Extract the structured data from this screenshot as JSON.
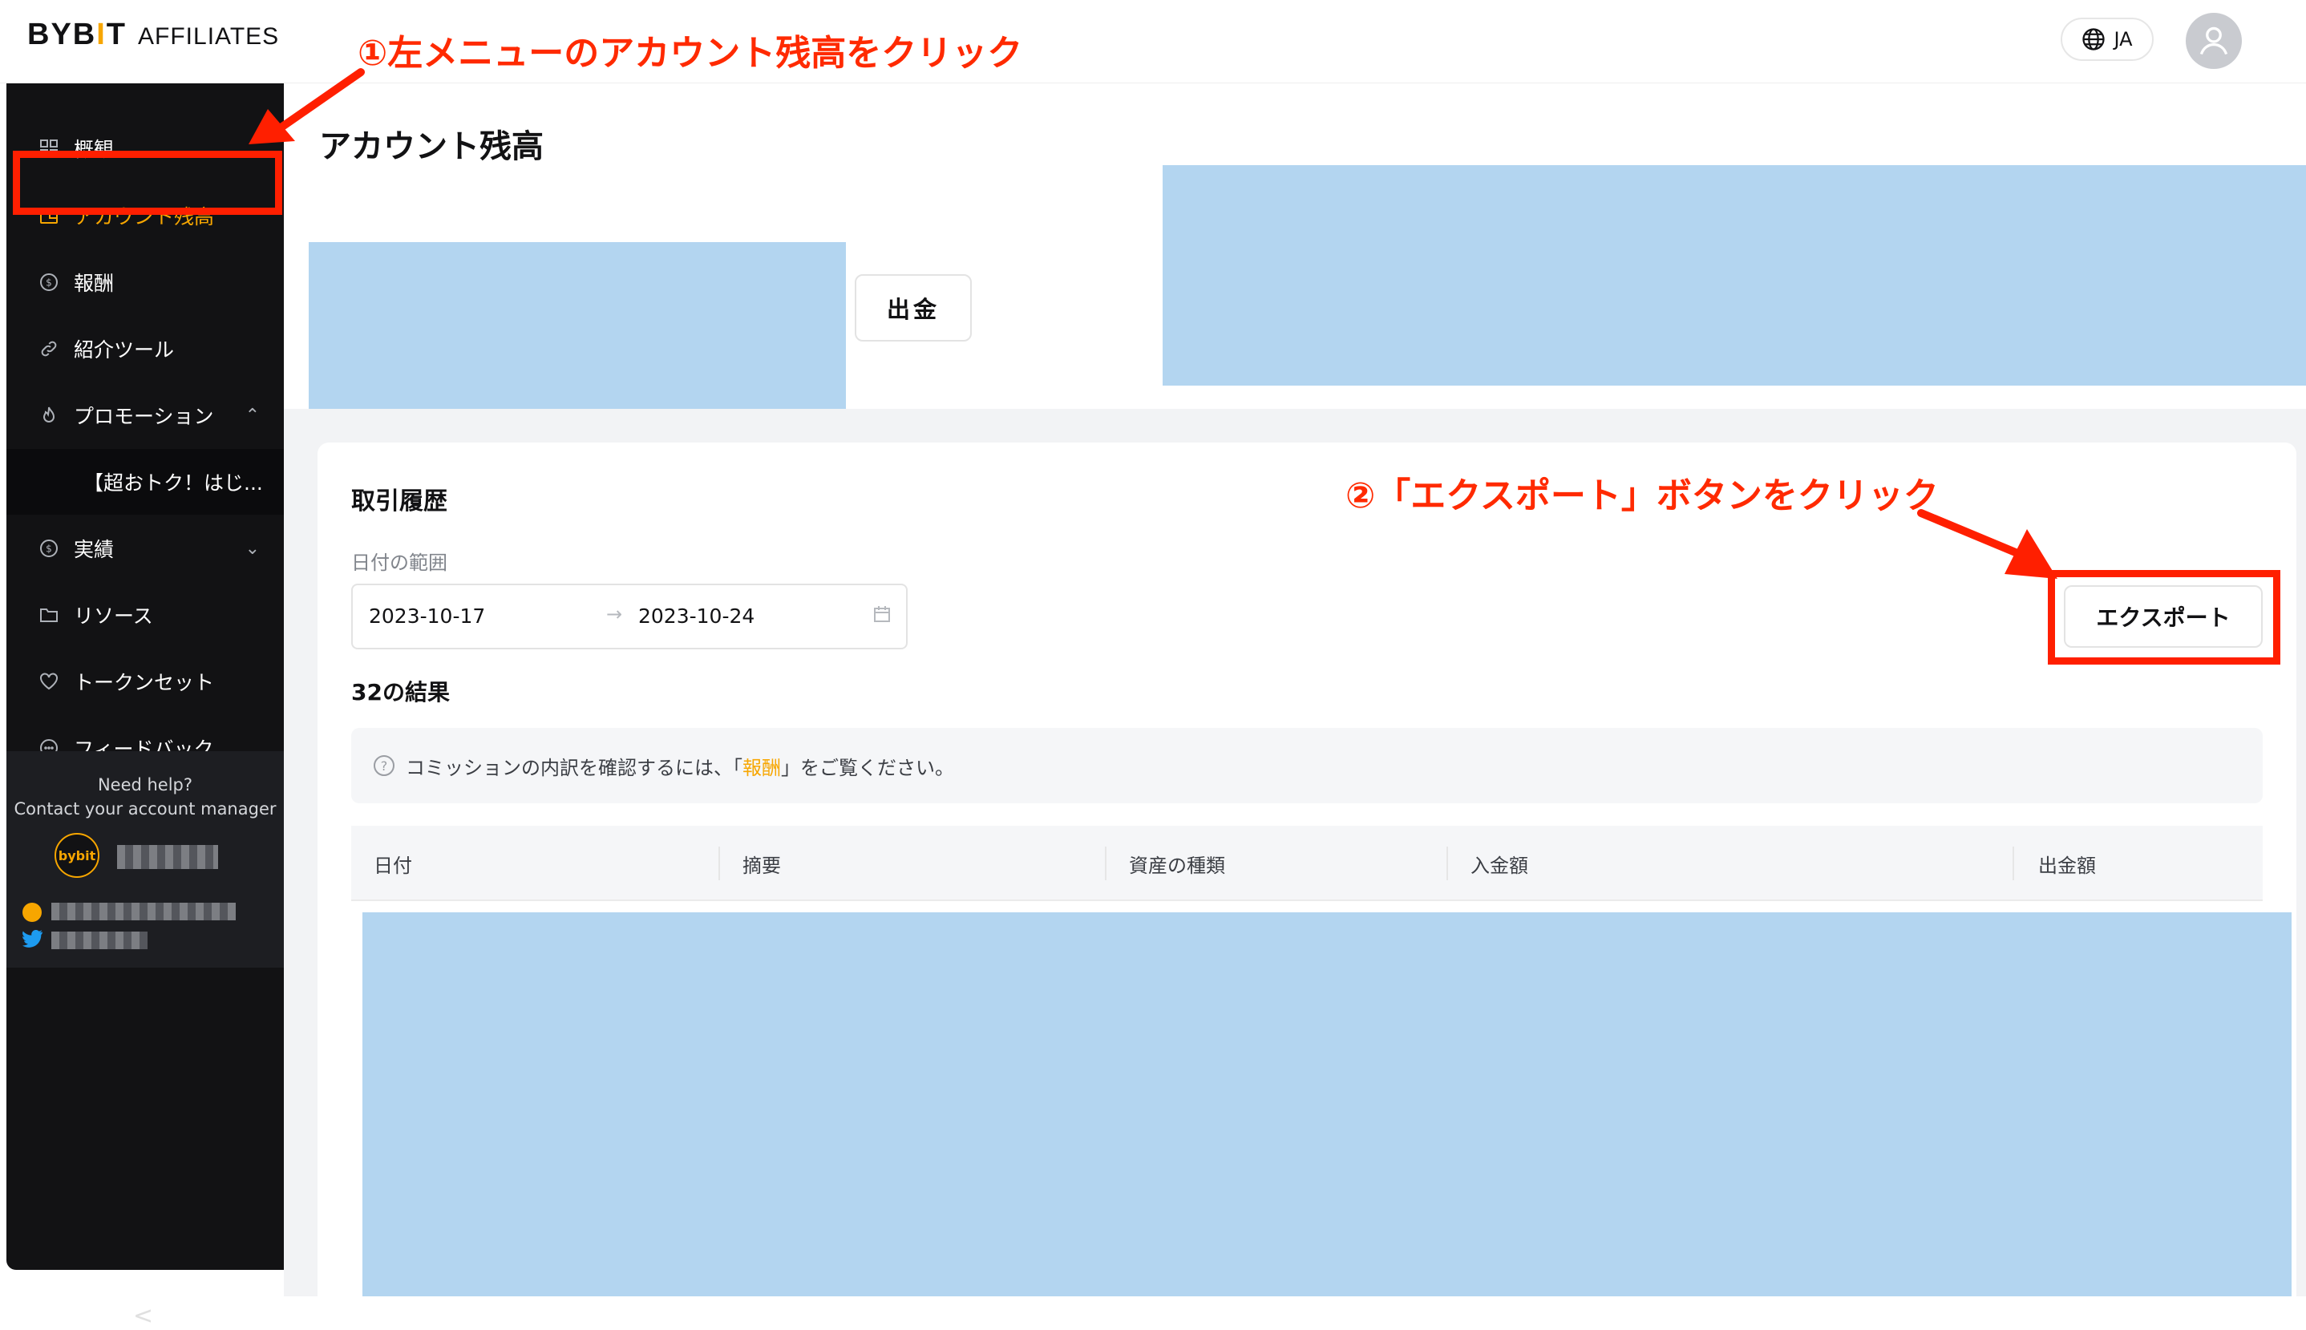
{
  "header": {
    "logo_mark": "BYB",
    "logo_mark_bar": "I",
    "logo_mark_end": "T",
    "logo_sub": "AFFILIATES",
    "language": "JA",
    "icons": [
      "globe-icon",
      "user-avatar-icon"
    ]
  },
  "sidebar": {
    "items": [
      {
        "label": "概観",
        "icon": "grid-icon"
      },
      {
        "label": "アカウント残高",
        "icon": "wallet-icon",
        "active": true
      },
      {
        "label": "報酬",
        "icon": "coin-icon"
      },
      {
        "label": "紹介ツール",
        "icon": "link-icon"
      },
      {
        "label": "プロモーション",
        "icon": "fire-icon",
        "expanded": true
      },
      {
        "label": "実績",
        "icon": "coin-icon",
        "expanded": false
      },
      {
        "label": "リソース",
        "icon": "folder-icon"
      },
      {
        "label": "トークンセット",
        "icon": "heart-icon"
      },
      {
        "label": "フィードバック",
        "icon": "chat-icon"
      }
    ],
    "sub_item": "【超おトク！はじ...",
    "help_line1": "Need help?",
    "help_line2": "Contact your account manager",
    "badge": "bybit",
    "collapse": "<"
  },
  "main": {
    "title": "アカウント残高",
    "withdraw_label": "出金"
  },
  "history": {
    "title": "取引履歴",
    "range_label": "日付の範囲",
    "start_date": "2023-10-17",
    "end_date": "2023-10-24",
    "export_label": "エクスポート",
    "results": "32の結果",
    "notice_before": "コミッションの内訳を確認するには、「",
    "notice_link": "報酬",
    "notice_after": "」をご覧ください。",
    "columns": [
      "日付",
      "摘要",
      "資産の種類",
      "入金額",
      "出金額"
    ]
  },
  "annotations": {
    "step1": "①左メニューのアカウント残高をクリック",
    "step2": "②「エクスポート」ボタンをクリック",
    "color": "#ff1f00"
  },
  "colors": {
    "accent": "#f7a600",
    "sidebar_bg": "#121214",
    "redaction": "#b3d5f0"
  }
}
